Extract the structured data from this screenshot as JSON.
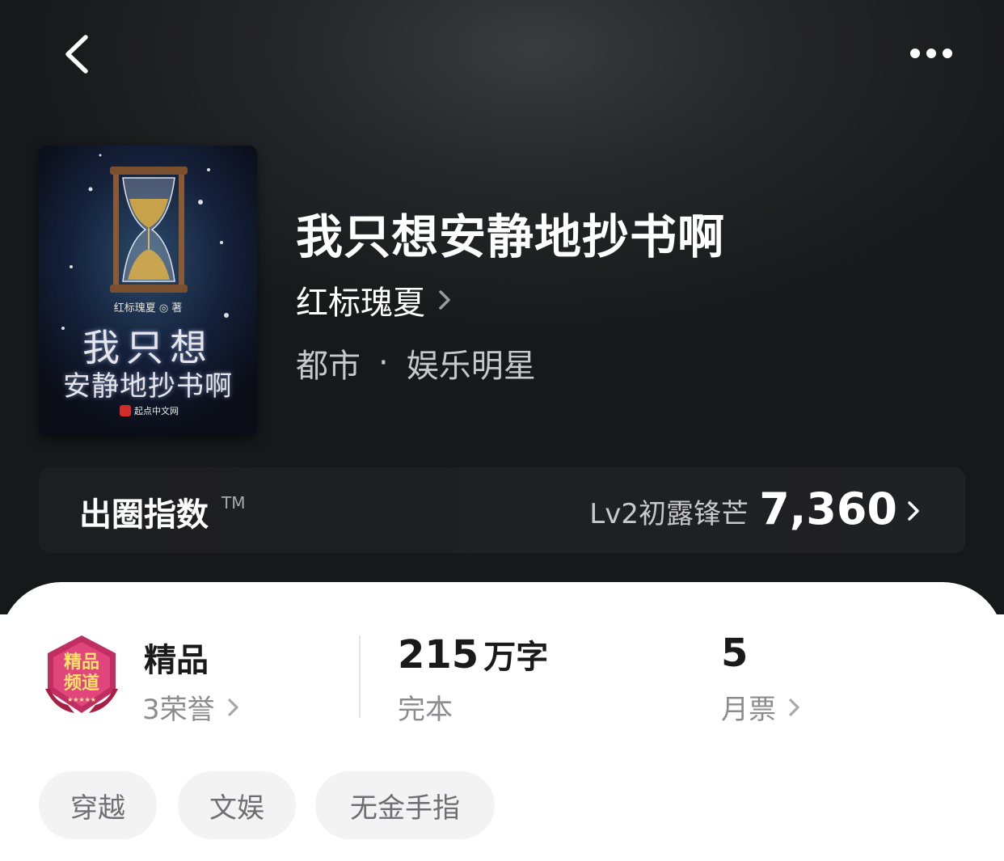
{
  "nav": {
    "back_icon": "chevron-left-icon",
    "more_icon": "more-horizontal-icon"
  },
  "cover": {
    "author_mark": "红标瑰夏 ◎ 著",
    "title_line1": "我只想",
    "title_line2": "安静地抄书啊",
    "publisher": "起点中文网"
  },
  "book": {
    "title": "我只想安静地抄书啊",
    "author": "红标瑰夏",
    "category": "都市",
    "category_separator": "·",
    "subcategory": "娱乐明星"
  },
  "index_bar": {
    "label": "出圈指数",
    "tm": "TM",
    "level": "Lv2初露锋芒",
    "score": "7,360"
  },
  "stats": {
    "badge_name": "精品",
    "badge_sub": "3荣誉",
    "word_count_number": "215",
    "word_count_unit": "万字",
    "status": "完本",
    "monthly_votes": "5",
    "monthly_votes_label": "月票"
  },
  "tags": [
    "穿越",
    "文娱",
    "无金手指"
  ],
  "colors": {
    "hero_bg": "#1c1d20",
    "badge_red": "#b8275a",
    "text_dark": "#1a1a1a",
    "text_muted": "#8c8c90",
    "tag_bg": "#f3f3f4"
  }
}
